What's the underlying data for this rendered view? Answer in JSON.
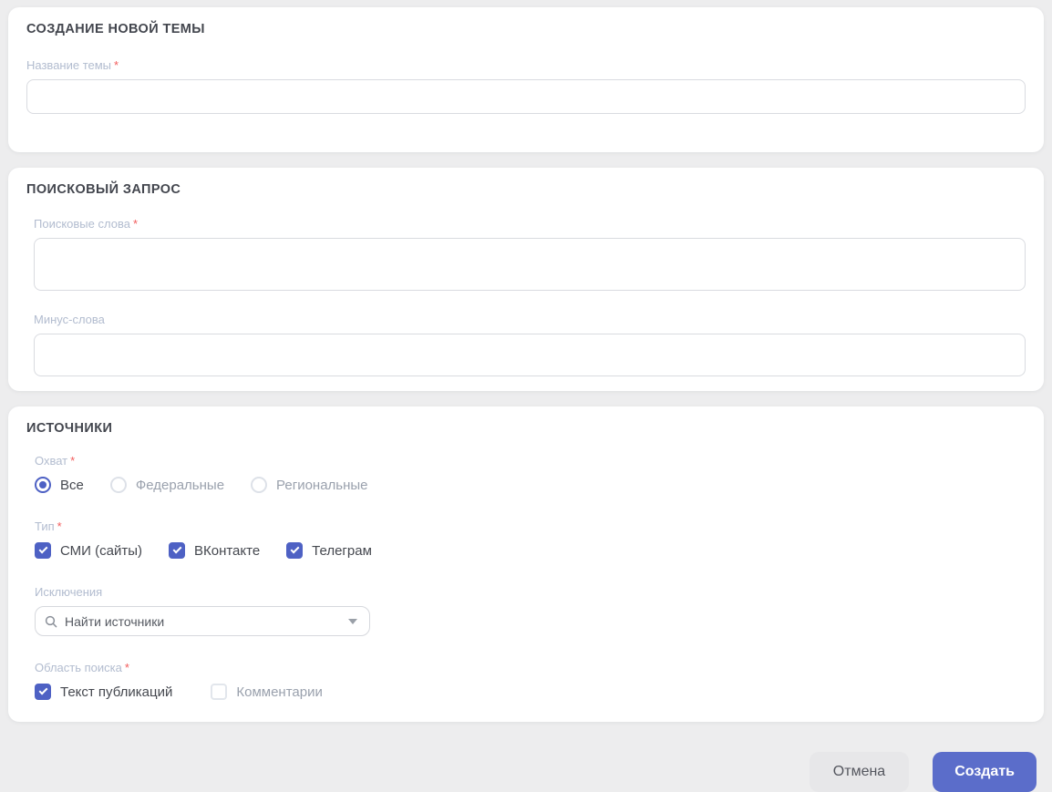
{
  "accent_color": "#4e61c4",
  "create_button_color": "#5b6dca",
  "required_mark": "*",
  "cards": {
    "topic": {
      "title": "СОЗДАНИЕ НОВОЙ ТЕМЫ",
      "name_label": "Название темы",
      "name_required": true,
      "name_value": ""
    },
    "query": {
      "title": "ПОИСКОВЫЙ ЗАПРОС",
      "keywords_label": "Поисковые слова",
      "keywords_required": true,
      "keywords_value": "",
      "minus_label": "Минус-слова",
      "minus_value": ""
    },
    "sources": {
      "title": "ИСТОЧНИКИ",
      "coverage_label": "Охват",
      "coverage_options": [
        {
          "label": "Все",
          "selected": true
        },
        {
          "label": "Федеральные",
          "selected": false
        },
        {
          "label": "Региональные",
          "selected": false
        }
      ],
      "type_label": "Тип",
      "type_options": [
        {
          "label": "СМИ (сайты)",
          "checked": true
        },
        {
          "label": "ВКонтакте",
          "checked": true
        },
        {
          "label": "Телеграм",
          "checked": true
        }
      ],
      "exclusions_label": "Исключения",
      "exclusions_placeholder": "Найти источники",
      "scope_label": "Область поиска",
      "scope_options": [
        {
          "label": "Текст публикаций",
          "checked": true
        },
        {
          "label": "Комментарии",
          "checked": false
        }
      ]
    }
  },
  "footer": {
    "cancel_label": "Отмена",
    "create_label": "Создать"
  }
}
